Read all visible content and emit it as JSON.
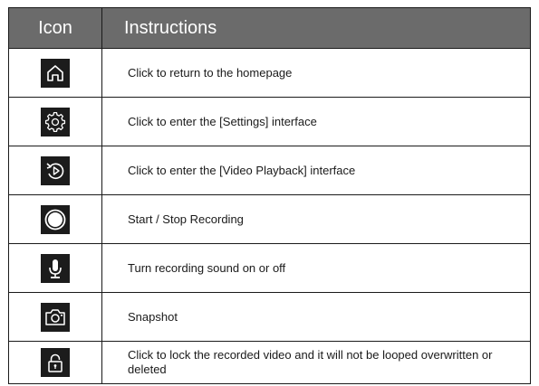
{
  "table": {
    "header": {
      "icon": "Icon",
      "instructions": "Instructions"
    },
    "rows": [
      {
        "icon": "home-icon",
        "text": "Click to return to the homepage"
      },
      {
        "icon": "gear-icon",
        "text": "Click to enter the [Settings] interface"
      },
      {
        "icon": "playback-icon",
        "text": "Click to enter the [Video Playback] interface"
      },
      {
        "icon": "record-icon",
        "text": "Start / Stop Recording"
      },
      {
        "icon": "microphone-icon",
        "text": "Turn recording sound on or off"
      },
      {
        "icon": "camera-icon",
        "text": "Snapshot"
      },
      {
        "icon": "lock-icon",
        "text": "Click to lock the recorded video and it will not be looped overwritten or deleted"
      }
    ]
  }
}
